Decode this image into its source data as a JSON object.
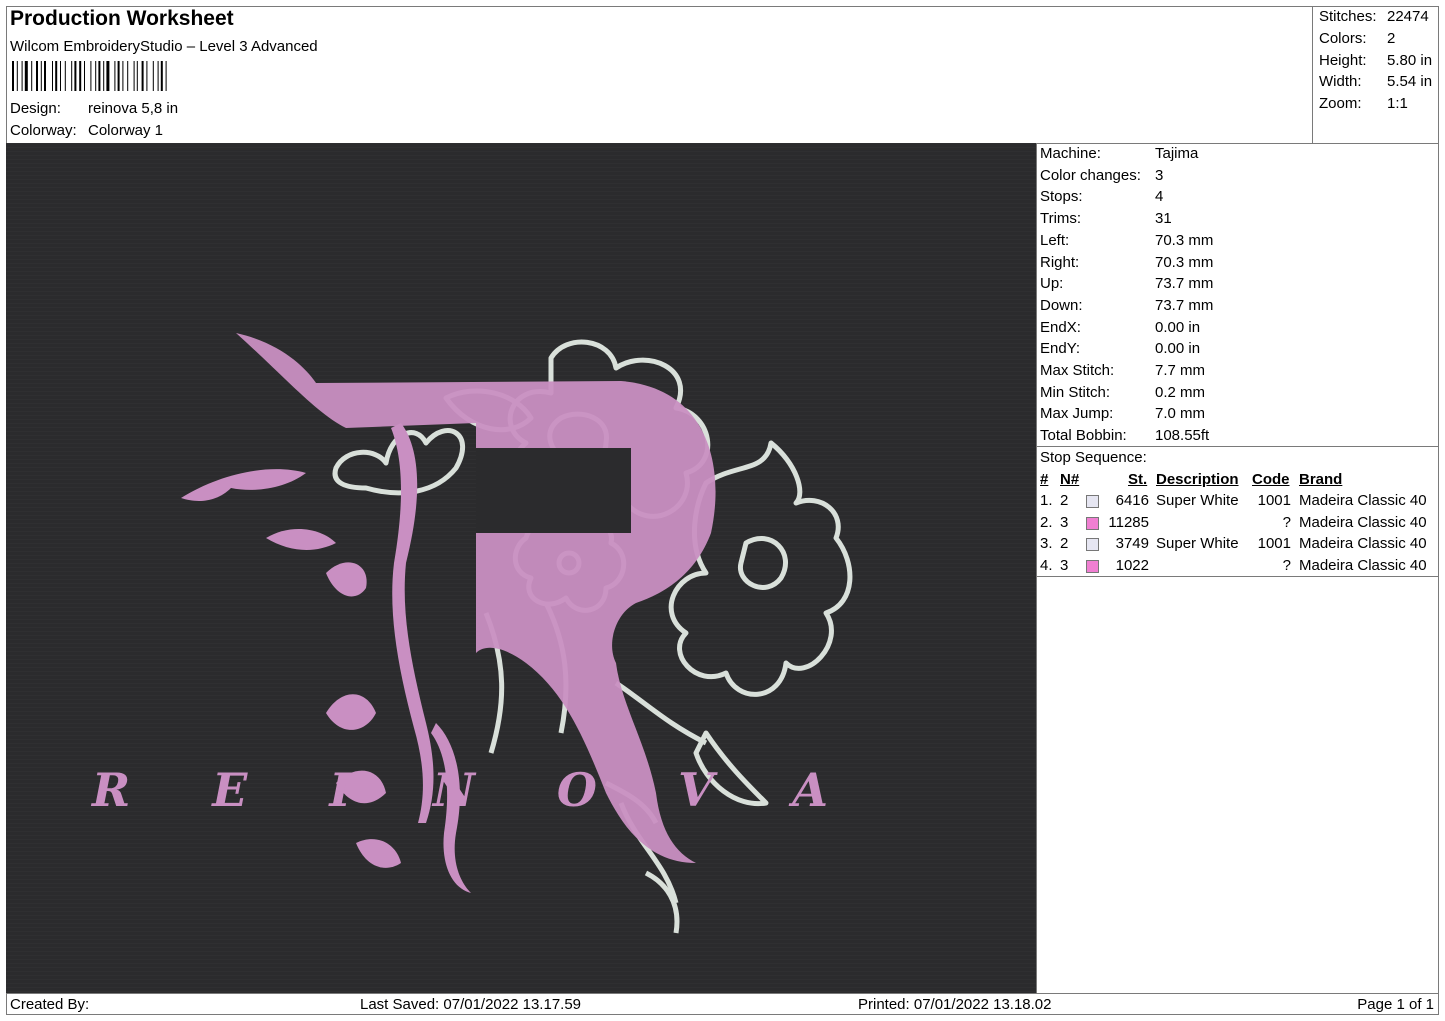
{
  "header": {
    "title": "Production Worksheet",
    "subtitle": "Wilcom EmbroideryStudio – Level 3 Advanced",
    "design_label": "Design:",
    "design_value": "reinova 5,8 in",
    "colorway_label": "Colorway:",
    "colorway_value": "Colorway 1"
  },
  "summary": {
    "stitches_label": "Stitches:",
    "stitches_value": "22474",
    "colors_label": "Colors:",
    "colors_value": "2",
    "height_label": "Height:",
    "height_value": "5.80 in",
    "width_label": "Width:",
    "width_value": "5.54 in",
    "zoom_label": "Zoom:",
    "zoom_value": "1:1"
  },
  "machine_info": [
    {
      "label": "Machine:",
      "value": "Tajima"
    },
    {
      "label": "Color changes:",
      "value": "3"
    },
    {
      "label": "Stops:",
      "value": "4"
    },
    {
      "label": "Trims:",
      "value": "31"
    },
    {
      "label": "Left:",
      "value": "70.3 mm"
    },
    {
      "label": "Right:",
      "value": "70.3 mm"
    },
    {
      "label": "Up:",
      "value": "73.7 mm"
    },
    {
      "label": "Down:",
      "value": "73.7 mm"
    },
    {
      "label": "EndX:",
      "value": "0.00 in"
    },
    {
      "label": "EndY:",
      "value": "0.00 in"
    },
    {
      "label": "Max Stitch:",
      "value": "7.7 mm"
    },
    {
      "label": "Min Stitch:",
      "value": "0.2 mm"
    },
    {
      "label": "Max Jump:",
      "value": "7.0 mm"
    },
    {
      "label": "Total Bobbin:",
      "value": "108.55ft"
    }
  ],
  "stop_sequence": {
    "title": "Stop Sequence:",
    "headers": {
      "num": "#",
      "needle": "N#",
      "stitches": "St.",
      "description": "Description",
      "code": "Code",
      "brand": "Brand"
    },
    "rows": [
      {
        "num": "1.",
        "needle": "2",
        "color": "#e6e6f2",
        "stitches": "6416",
        "description": "Super White",
        "code": "1001",
        "brand": "Madeira Classic 40"
      },
      {
        "num": "2.",
        "needle": "3",
        "color": "#f07fd2",
        "stitches": "11285",
        "description": "",
        "code": "?",
        "brand": "Madeira Classic 40"
      },
      {
        "num": "3.",
        "needle": "2",
        "color": "#e6e6f2",
        "stitches": "3749",
        "description": "Super White",
        "code": "1001",
        "brand": "Madeira Classic 40"
      },
      {
        "num": "4.",
        "needle": "3",
        "color": "#f07fd2",
        "stitches": "1022",
        "description": "",
        "code": "?",
        "brand": "Madeira Classic 40"
      }
    ]
  },
  "artwork": {
    "text": "REINOVA",
    "pink": "#c98fc2",
    "white": "#d9e0da",
    "fabric": "#2b2b2d"
  },
  "footer": {
    "created_by": "Created By:",
    "last_saved": "Last Saved: 07/01/2022 13.17.59",
    "printed": "Printed: 07/01/2022 13.18.02",
    "page": "Page 1 of 1"
  }
}
